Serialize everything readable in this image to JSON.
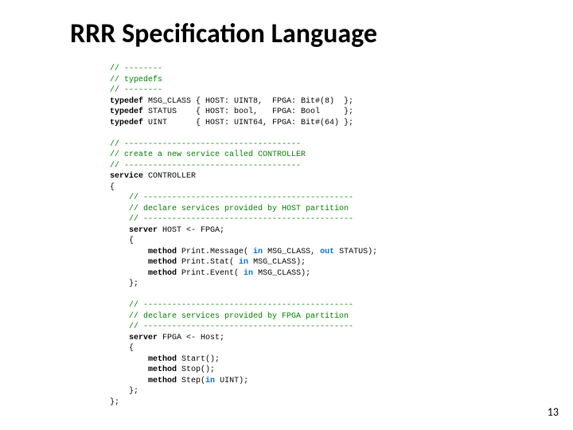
{
  "slide": {
    "title": "RRR Specification Language",
    "page_number": "13"
  },
  "code": {
    "c01": "// --------",
    "c02": "// typedefs",
    "c03": "// --------",
    "t1a": "typedef",
    "t1b": " MSG_CLASS { HOST: UINT8,  FPGA: Bit#(8)  };",
    "t2a": "typedef",
    "t2b": " STATUS    { HOST: bool,   FPGA: Bool     };",
    "t3a": "typedef",
    "t3b": " UINT      { HOST: UINT64, FPGA: Bit#(64) };",
    "blank": " ",
    "c04": "// -------------------------------------",
    "c05": "// create a new service called CONTROLLER",
    "c06": "// -------------------------------------",
    "s1a": "service",
    "s1b": " CONTROLLER",
    "ob": "{",
    "c07": "    // --------------------------------------------",
    "c08": "    // declare services provided by HOST partition",
    "c09": "    // --------------------------------------------",
    "srv1pre": "    ",
    "srv1kw": "server",
    "srv1rest": " HOST <- FPGA;",
    "ob2": "    {",
    "m1pre": "        ",
    "m1kw": "method",
    "m1mid": " Print.Message( ",
    "m1in": "in",
    "m1a": " MSG_CLASS, ",
    "m1out": "out",
    "m1b": " STATUS);",
    "m2pre": "        ",
    "m2kw": "method",
    "m2mid": " Print.Stat( ",
    "m2in": "in",
    "m2a": " MSG_CLASS);",
    "m3pre": "        ",
    "m3kw": "method",
    "m3mid": " Print.Event( ",
    "m3in": "in",
    "m3a": " MSG_CLASS);",
    "cb2": "    };",
    "c10": "    // --------------------------------------------",
    "c11": "    // declare services provided by FPGA partition",
    "c12": "    // --------------------------------------------",
    "srv2pre": "    ",
    "srv2kw": "server",
    "srv2rest": " FPGA <- Host;",
    "ob3": "    {",
    "m4pre": "        ",
    "m4kw": "method",
    "m4a": " Start();",
    "m5pre": "        ",
    "m5kw": "method",
    "m5a": " Stop();",
    "m6pre": "        ",
    "m6kw": "method",
    "m6mid": " Step(",
    "m6in": "in",
    "m6a": " UINT);",
    "cb3": "    };",
    "cb": "};"
  }
}
